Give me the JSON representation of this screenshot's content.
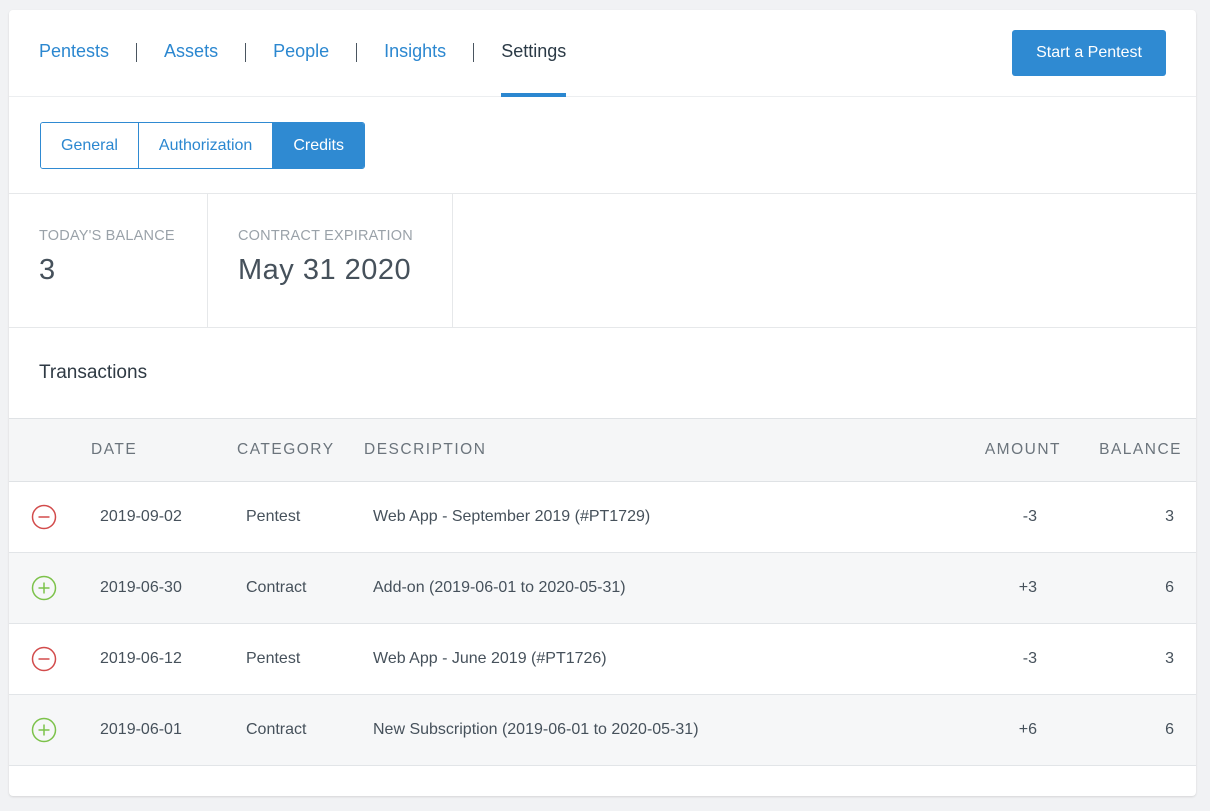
{
  "nav": {
    "items": [
      {
        "label": "Pentests"
      },
      {
        "label": "Assets"
      },
      {
        "label": "People"
      },
      {
        "label": "Insights"
      },
      {
        "label": "Settings"
      }
    ],
    "active": "Settings",
    "cta_label": "Start a Pentest"
  },
  "subtabs": {
    "items": [
      {
        "label": "General"
      },
      {
        "label": "Authorization"
      },
      {
        "label": "Credits"
      }
    ],
    "active": "Credits"
  },
  "stats": {
    "balance_label": "TODAY'S BALANCE",
    "balance_value": "3",
    "expiration_label": "CONTRACT EXPIRATION",
    "expiration_value": "May 31 2020"
  },
  "transactions": {
    "title": "Transactions",
    "columns": {
      "date": "DATE",
      "category": "CATEGORY",
      "description": "DESCRIPTION",
      "amount": "AMOUNT",
      "balance": "BALANCE"
    },
    "rows": [
      {
        "type": "debit",
        "icon": "minus-circle-icon",
        "date": "2019-09-02",
        "category": "Pentest",
        "description": "Web App - September 2019 (#PT1729)",
        "amount": "-3",
        "balance": "3"
      },
      {
        "type": "credit",
        "icon": "plus-circle-icon",
        "date": "2019-06-30",
        "category": "Contract",
        "description": "Add-on (2019-06-01 to 2020-05-31)",
        "amount": "+3",
        "balance": "6"
      },
      {
        "type": "debit",
        "icon": "minus-circle-icon",
        "date": "2019-06-12",
        "category": "Pentest",
        "description": "Web App - June 2019 (#PT1726)",
        "amount": "-3",
        "balance": "3"
      },
      {
        "type": "credit",
        "icon": "plus-circle-icon",
        "date": "2019-06-01",
        "category": "Contract",
        "description": "New Subscription (2019-06-01 to 2020-05-31)",
        "amount": "+6",
        "balance": "6"
      }
    ]
  },
  "colors": {
    "accent": "#2f8ad2",
    "debit": "#d24b4b",
    "credit": "#7cc24a"
  }
}
